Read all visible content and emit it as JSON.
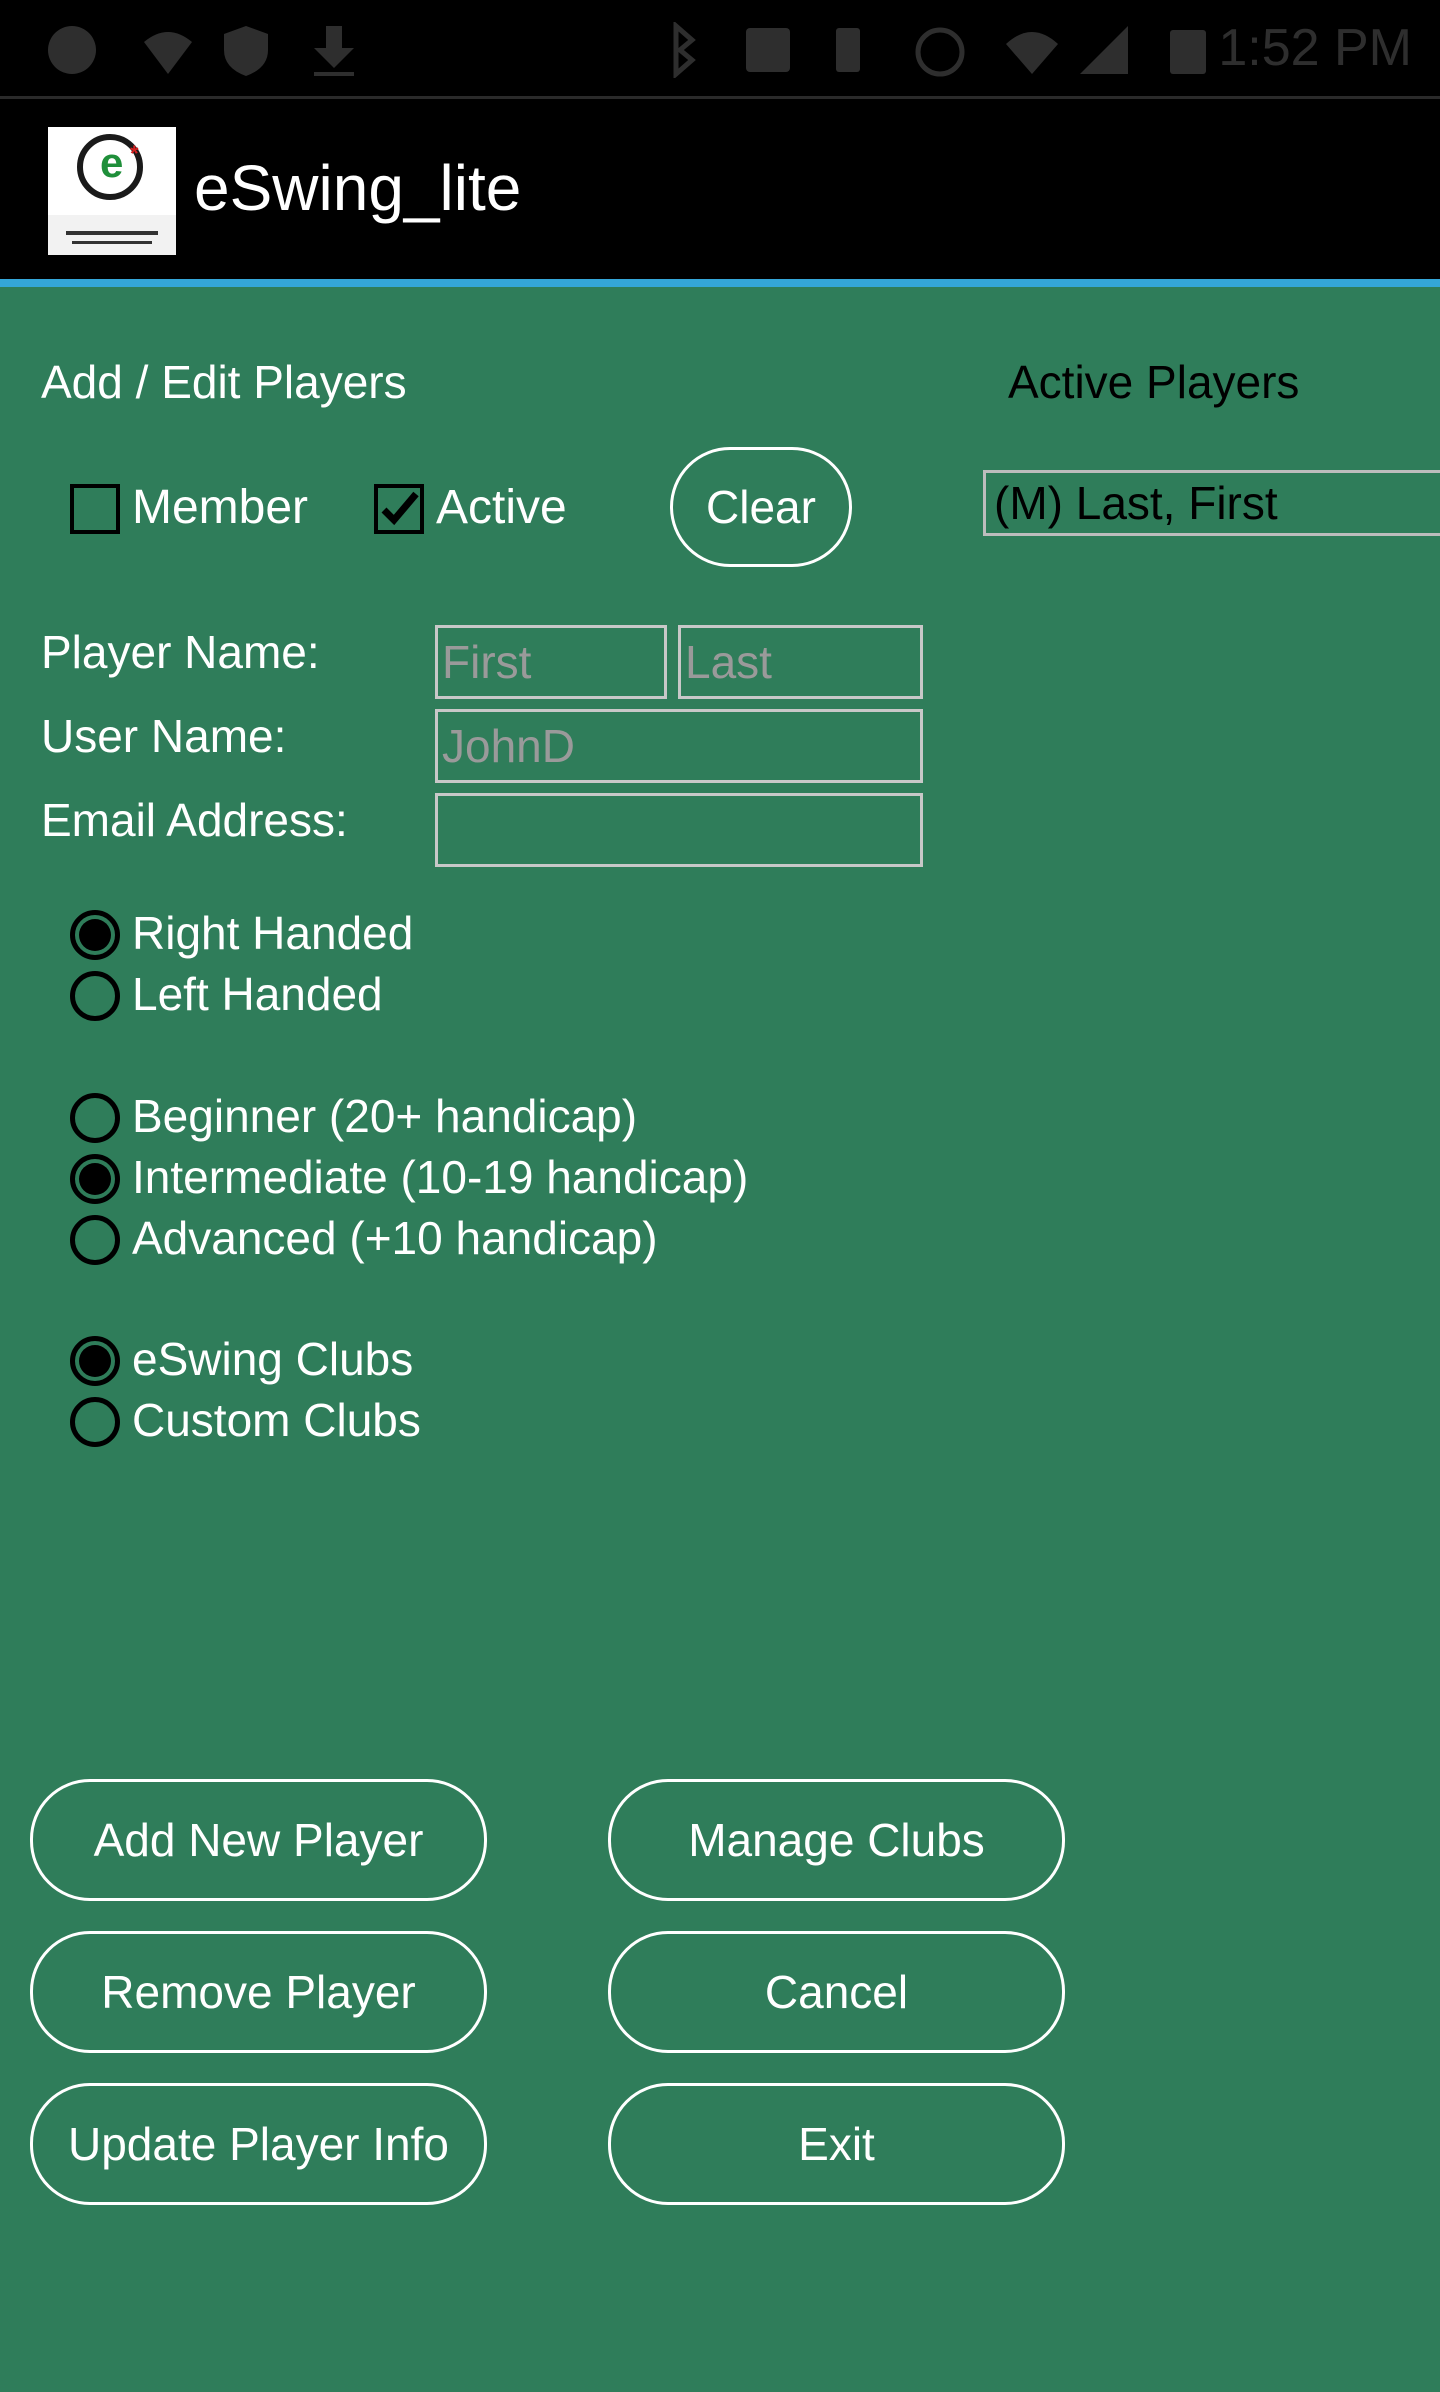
{
  "status_bar": {
    "time": "1:52 PM"
  },
  "app": {
    "title": "eSwing_lite",
    "logo_text": "eSwing"
  },
  "editor": {
    "section_title": "Add / Edit Players",
    "member_label": "Member",
    "member_checked": false,
    "active_label": "Active",
    "active_checked": true,
    "clear_label": "Clear"
  },
  "active_players": {
    "title": "Active Players",
    "items": [
      "(M) Last, First"
    ]
  },
  "form": {
    "player_name_label": "Player Name:",
    "first_placeholder": "First",
    "last_placeholder": "Last",
    "user_name_label": "User Name:",
    "user_name_placeholder": "JohnD",
    "email_label": "Email Address:",
    "email_value": ""
  },
  "handedness": {
    "options": [
      "Right Handed",
      "Left Handed"
    ],
    "selected": "Right Handed"
  },
  "skill": {
    "options": [
      "Beginner (20+ handicap)",
      "Intermediate (10-19 handicap)",
      "Advanced (+10 handicap)"
    ],
    "selected": "Intermediate (10-19 handicap)"
  },
  "clubs": {
    "options": [
      "eSwing Clubs",
      "Custom Clubs"
    ],
    "selected": "eSwing Clubs"
  },
  "buttons": {
    "add_new_player": "Add New Player",
    "manage_clubs": "Manage Clubs",
    "remove_player": "Remove Player",
    "cancel": "Cancel",
    "update_player_info": "Update Player Info",
    "exit": "Exit"
  },
  "colors": {
    "background": "#2f7d5a",
    "appbar": "#000000",
    "accent": "#34a6d8"
  }
}
